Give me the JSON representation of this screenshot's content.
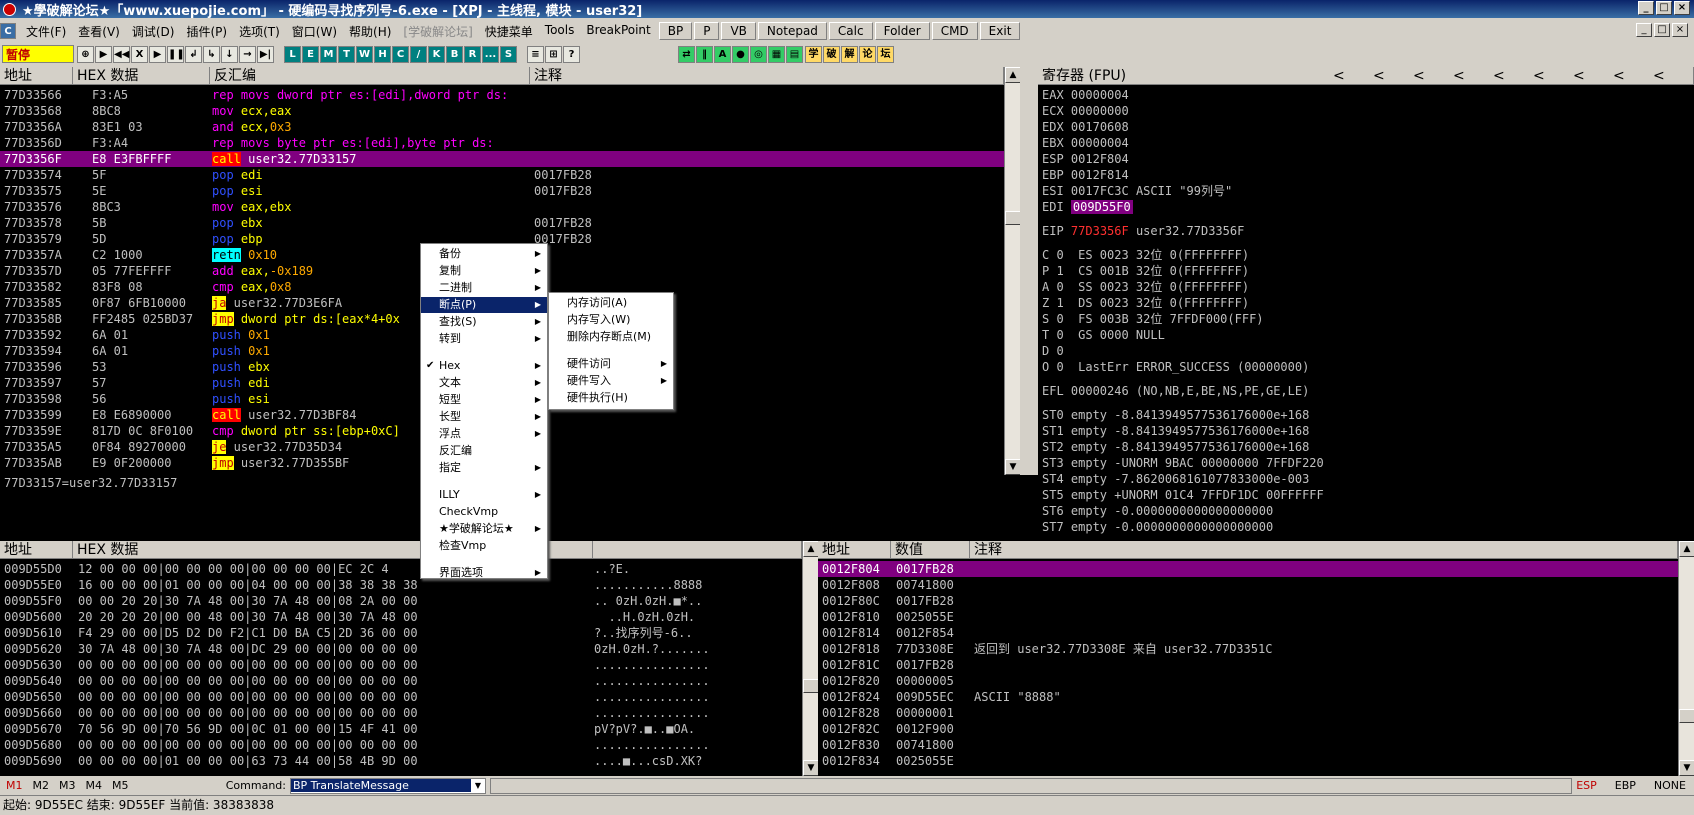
{
  "window": {
    "title": "★學破解论坛★「www.xuepojie.com」 - 硬编码寻找序列号-6.exe - [XPJ - 主线程, 模块 - user32]",
    "btn_min": "_",
    "btn_max": "□",
    "btn_close": "×",
    "mdi_min": "_",
    "mdi_max": "□",
    "mdi_close": "×"
  },
  "menu": {
    "items": [
      "文件(F)",
      "查看(V)",
      "调试(D)",
      "插件(P)",
      "选项(T)",
      "窗口(W)",
      "帮助(H)"
    ],
    "disabled": "[学破解论坛]",
    "extra": [
      "快捷菜单",
      "Tools",
      "BreakPoint"
    ],
    "buttons": [
      "BP",
      "P",
      "VB",
      "Notepad",
      "Calc",
      "Folder",
      "CMD",
      "Exit"
    ]
  },
  "toolbar": {
    "status": "暂停",
    "left_buttons": [
      "⊕",
      "▶",
      "◀◀",
      "X",
      "▶",
      "❚❚",
      "↲",
      "↳",
      "↓",
      "→",
      "▶|"
    ],
    "letters": [
      "L",
      "E",
      "M",
      "T",
      "W",
      "H",
      "C",
      "/",
      "K",
      "B",
      "R",
      "...",
      "S"
    ],
    "grid_buttons": [
      "≡",
      "⊞",
      "?"
    ],
    "right_buttons": [
      "⇄",
      "‖",
      "A",
      "●",
      "◎",
      "▦",
      "▤"
    ],
    "cn_buttons": [
      "学",
      "破",
      "解",
      "论",
      "坛"
    ]
  },
  "cpu": {
    "headers": [
      "地址",
      "HEX 数据",
      "反汇编",
      "注释"
    ],
    "rows": [
      {
        "addr": "77D33566",
        "hex": "F3:A5",
        "asm": [
          {
            "t": "rep movs",
            "c": "kw-p"
          },
          {
            "t": " dword ptr es:[edi],dword ptr ds:",
            "c": "kw-p"
          }
        ],
        "cm": ""
      },
      {
        "addr": "77D33568",
        "hex": "8BC8",
        "asm": [
          {
            "t": "mov",
            "c": "kw-p"
          },
          {
            "t": " ecx,eax",
            "c": "kw-y"
          }
        ],
        "cm": ""
      },
      {
        "addr": "77D3356A",
        "hex": "83E1 03",
        "asm": [
          {
            "t": "and",
            "c": "kw-p"
          },
          {
            "t": " ecx,",
            "c": "kw-y"
          },
          {
            "t": "0x3",
            "c": "imm"
          }
        ],
        "cm": ""
      },
      {
        "addr": "77D3356D",
        "hex": "F3:A4",
        "asm": [
          {
            "t": "rep movs",
            "c": "kw-p"
          },
          {
            "t": " byte ptr es:[edi],byte ptr ds:",
            "c": "kw-p"
          }
        ],
        "cm": ""
      },
      {
        "addr": "77D3356F",
        "hex": "E8 E3FBFFFF",
        "asm": [
          {
            "t": "call",
            "c": "kw-r"
          },
          {
            "t": " user32.77D33157",
            "c": ""
          }
        ],
        "cm": "",
        "sel": true
      },
      {
        "addr": "77D33574",
        "hex": "5F",
        "asm": [
          {
            "t": "pop",
            "c": "kw-b"
          },
          {
            "t": " edi",
            "c": "kw-y"
          }
        ],
        "cm": "0017FB28"
      },
      {
        "addr": "77D33575",
        "hex": "5E",
        "asm": [
          {
            "t": "pop",
            "c": "kw-b"
          },
          {
            "t": " esi",
            "c": "kw-y"
          }
        ],
        "cm": "0017FB28"
      },
      {
        "addr": "77D33576",
        "hex": "8BC3",
        "asm": [
          {
            "t": "mov",
            "c": "kw-p"
          },
          {
            "t": " eax,ebx",
            "c": "kw-y"
          }
        ],
        "cm": ""
      },
      {
        "addr": "77D33578",
        "hex": "5B",
        "asm": [
          {
            "t": "pop",
            "c": "kw-b"
          },
          {
            "t": " ebx",
            "c": "kw-y"
          }
        ],
        "cm": "0017FB28"
      },
      {
        "addr": "77D33579",
        "hex": "5D",
        "asm": [
          {
            "t": "pop",
            "c": "kw-b"
          },
          {
            "t": " ebp",
            "c": "kw-y"
          }
        ],
        "cm": "0017FB28"
      },
      {
        "addr": "77D3357A",
        "hex": "C2 1000",
        "asm": [
          {
            "t": "retn",
            "c": "kw-c"
          },
          {
            "t": " 0x10",
            "c": "imm"
          }
        ],
        "cm": ""
      },
      {
        "addr": "77D3357D",
        "hex": "05 77FEFFFF",
        "asm": [
          {
            "t": "add",
            "c": "kw-p"
          },
          {
            "t": " eax,",
            "c": "kw-y"
          },
          {
            "t": "-0x189",
            "c": "imm"
          }
        ],
        "cm": ""
      },
      {
        "addr": "77D33582",
        "hex": "83F8 08",
        "asm": [
          {
            "t": "cmp",
            "c": "kw-p"
          },
          {
            "t": " eax,",
            "c": "kw-y"
          },
          {
            "t": "0x8",
            "c": "imm"
          }
        ],
        "cm": ""
      },
      {
        "addr": "77D33585",
        "hex": "0F87 6FB10000",
        "asm": [
          {
            "t": "ja",
            "c": "kw-j"
          },
          {
            "t": " user32.77D3E6FA",
            "c": ""
          }
        ],
        "cm": ""
      },
      {
        "addr": "77D3358B",
        "hex": "FF2485 025BD37",
        "asm": [
          {
            "t": "jmp",
            "c": "kw-j"
          },
          {
            "t": " dword ptr ds:[eax*4+0x",
            "c": "kw-y"
          }
        ],
        "cm": ""
      },
      {
        "addr": "77D33592",
        "hex": "6A 01",
        "asm": [
          {
            "t": "push",
            "c": "kw-b"
          },
          {
            "t": " 0x1",
            "c": "imm"
          }
        ],
        "cm": ""
      },
      {
        "addr": "77D33594",
        "hex": "6A 01",
        "asm": [
          {
            "t": "push",
            "c": "kw-b"
          },
          {
            "t": " 0x1",
            "c": "imm"
          }
        ],
        "cm": ""
      },
      {
        "addr": "77D33596",
        "hex": "53",
        "asm": [
          {
            "t": "push",
            "c": "kw-b"
          },
          {
            "t": " ebx",
            "c": "kw-y"
          }
        ],
        "cm": ""
      },
      {
        "addr": "77D33597",
        "hex": "57",
        "asm": [
          {
            "t": "push",
            "c": "kw-b"
          },
          {
            "t": " edi",
            "c": "kw-y"
          }
        ],
        "cm": ""
      },
      {
        "addr": "77D33598",
        "hex": "56",
        "asm": [
          {
            "t": "push",
            "c": "kw-b"
          },
          {
            "t": " esi",
            "c": "kw-y"
          }
        ],
        "cm": ""
      },
      {
        "addr": "77D33599",
        "hex": "E8 E6890000",
        "asm": [
          {
            "t": "call",
            "c": "kw-r"
          },
          {
            "t": " user32.77D3BF84",
            "c": ""
          }
        ],
        "cm": ""
      },
      {
        "addr": "77D3359E",
        "hex": "817D 0C 8F0100",
        "asm": [
          {
            "t": "cmp",
            "c": "kw-p"
          },
          {
            "t": " dword ptr ss:[ebp+0xC]",
            "c": "kw-y"
          }
        ],
        "cm": ""
      },
      {
        "addr": "77D335A5",
        "hex": "0F84 89270000",
        "asm": [
          {
            "t": "je",
            "c": "kw-j"
          },
          {
            "t": " user32.77D35D34",
            "c": ""
          }
        ],
        "cm": ""
      },
      {
        "addr": "77D335AB",
        "hex": "E9 0F200000",
        "asm": [
          {
            "t": "jmp",
            "c": "kw-j"
          },
          {
            "t": " user32.77D355BF",
            "c": ""
          }
        ],
        "cm": ""
      }
    ],
    "info": "77D33157=user32.77D33157"
  },
  "registers": {
    "header": "寄存器 (FPU)",
    "arrows": [
      "<",
      "<",
      "<",
      "<",
      "<",
      "<",
      "<",
      "<",
      "<"
    ],
    "gp": [
      [
        "EAX",
        "00000004",
        ""
      ],
      [
        "ECX",
        "00000000",
        ""
      ],
      [
        "EDX",
        "00170608",
        ""
      ],
      [
        "EBX",
        "00000004",
        ""
      ],
      [
        "ESP",
        "0012F804",
        ""
      ],
      [
        "EBP",
        "0012F814",
        ""
      ],
      [
        "ESI",
        "0017FC3C",
        "ASCII \"99列号\""
      ],
      [
        "EDI",
        "009D55F0",
        ""
      ]
    ],
    "eip": [
      "EIP",
      "77D3356F",
      "user32.77D3356F"
    ],
    "flags": [
      "C 0  ES 0023 32位 0(FFFFFFFF)",
      "P 1  CS 001B 32位 0(FFFFFFFF)",
      "A 0  SS 0023 32位 0(FFFFFFFF)",
      "Z 1  DS 0023 32位 0(FFFFFFFF)",
      "S 0  FS 003B 32位 7FFDF000(FFF)",
      "T 0  GS 0000 NULL",
      "D 0",
      "O 0  LastErr ERROR_SUCCESS (00000000)"
    ],
    "efl": "EFL 00000246 (NO,NB,E,BE,NS,PE,GE,LE)",
    "fpu": [
      "ST0 empty -8.8413949577536176000e+168",
      "ST1 empty -8.8413949577536176000e+168",
      "ST2 empty -8.8413949577536176000e+168",
      "ST3 empty -UNORM 9BAC 00000000 7FFDF220",
      "ST4 empty -7.8620068161077833000e-003",
      "ST5 empty +UNORM 01C4 7FFDF1DC 00FFFFFF",
      "ST6 empty -0.0000000000000000000",
      "ST7 empty -0.0000000000000000000"
    ]
  },
  "dump": {
    "headers": [
      "地址",
      "HEX 数据",
      ""
    ],
    "rows": [
      [
        "009D55D0",
        "12 00 00 00|00 00 00 00|00 00 00 00|EC 2C 4",
        "..?E."
      ],
      [
        "009D55E0",
        "16 00 00 00|01 00 00 00|04 00 00 00|38 38 38 38",
        "...........8888"
      ],
      [
        "009D55F0",
        "00 00 20 20|30 7A 48 00|30 7A 48 00|08 2A 00 00",
        ".. 0zH.0zH.■*.."
      ],
      [
        "009D5600",
        "20 20 20 20|00 00 48 00|30 7A 48 00|30 7A 48 00",
        "  ..H.0zH.0zH."
      ],
      [
        "009D5610",
        "F4 29 00 00|D5 D2 D0 F2|C1 D0 BA C5|2D 36 00 00",
        "?..找序列号-6.."
      ],
      [
        "009D5620",
        "30 7A 48 00|30 7A 48 00|DC 29 00 00|00 00 00 00",
        "0zH.0zH.?......."
      ],
      [
        "009D5630",
        "00 00 00 00|00 00 00 00|00 00 00 00|00 00 00 00",
        "................"
      ],
      [
        "009D5640",
        "00 00 00 00|00 00 00 00|00 00 00 00|00 00 00 00",
        "................"
      ],
      [
        "009D5650",
        "00 00 00 00|00 00 00 00|00 00 00 00|00 00 00 00",
        "................"
      ],
      [
        "009D5660",
        "00 00 00 00|00 00 00 00|00 00 00 00|00 00 00 00",
        "................"
      ],
      [
        "009D5670",
        "70 56 9D 00|70 56 9D 00|0C 01 00 00|15 4F 41 00",
        "pV?pV?.■..■OA."
      ],
      [
        "009D5680",
        "00 00 00 00|00 00 00 00|00 00 00 00|00 00 00 00",
        "................"
      ],
      [
        "009D5690",
        "00 00 00 00|01 00 00 00|63 73 44 00|58 4B 9D 00",
        "....■...csD.XK?"
      ]
    ]
  },
  "stack": {
    "headers": [
      "地址",
      "数值",
      "注释"
    ],
    "rows": [
      [
        "0012F804",
        "0017FB28",
        "",
        true
      ],
      [
        "0012F808",
        "00741800",
        "",
        false
      ],
      [
        "0012F80C",
        "0017FB28",
        "",
        false
      ],
      [
        "0012F810",
        "0025055E",
        "",
        false
      ],
      [
        "0012F814",
        "0012F854",
        "",
        false
      ],
      [
        "0012F818",
        "77D3308E",
        "返回到 user32.77D3308E 来自 user32.77D3351C",
        false
      ],
      [
        "0012F81C",
        "0017FB28",
        "",
        false
      ],
      [
        "0012F820",
        "00000005",
        "",
        false
      ],
      [
        "0012F824",
        "009D55EC",
        "ASCII \"8888\"",
        false
      ],
      [
        "0012F828",
        "00000001",
        "",
        false
      ],
      [
        "0012F82C",
        "0012F900",
        "",
        false
      ],
      [
        "0012F830",
        "00741800",
        "",
        false
      ],
      [
        "0012F834",
        "0025055E",
        "",
        false
      ]
    ]
  },
  "context_menu": {
    "items": [
      {
        "label": "备份",
        "arrow": true
      },
      {
        "label": "复制",
        "arrow": true
      },
      {
        "label": "二进制",
        "arrow": true
      },
      {
        "label": "断点(P)",
        "arrow": true,
        "hi": true
      },
      {
        "label": "查找(S)",
        "arrow": true
      },
      {
        "label": "转到",
        "arrow": true
      },
      {
        "sep": true
      },
      {
        "label": "Hex",
        "arrow": true,
        "check": true
      },
      {
        "label": "文本",
        "arrow": true
      },
      {
        "label": "短型",
        "arrow": true
      },
      {
        "label": "长型",
        "arrow": true
      },
      {
        "label": "浮点",
        "arrow": true
      },
      {
        "label": "反汇编",
        "arrow": false
      },
      {
        "label": "指定",
        "arrow": true
      },
      {
        "sep": true
      },
      {
        "label": "ILLY",
        "arrow": true
      },
      {
        "label": "CheckVmp",
        "arrow": false
      },
      {
        "label": "★学破解论坛★",
        "arrow": true
      },
      {
        "label": "检查Vmp",
        "arrow": false
      },
      {
        "sep": true
      },
      {
        "label": "界面选项",
        "arrow": true
      }
    ],
    "submenu": [
      {
        "label": "内存访问(A)",
        "arrow": false
      },
      {
        "label": "内存写入(W)",
        "arrow": false
      },
      {
        "label": "删除内存断点(M)",
        "arrow": false
      },
      {
        "sep": true
      },
      {
        "label": "硬件访问",
        "arrow": true
      },
      {
        "label": "硬件写入",
        "arrow": true
      },
      {
        "label": "硬件执行(H)",
        "arrow": false
      }
    ]
  },
  "command": {
    "tabs": [
      "M1",
      "M2",
      "M3",
      "M4",
      "M5"
    ],
    "label": "Command:",
    "value": "BP TranslateMessage",
    "right": [
      "ESP",
      "EBP",
      "NONE"
    ]
  },
  "status": "起始: 9D55EC 结束: 9D55EF 当前值: 38383838",
  "colors": {
    "selected_row": "#800080",
    "accent_red": "#ff0000",
    "accent_yellow": "#ffff00"
  }
}
